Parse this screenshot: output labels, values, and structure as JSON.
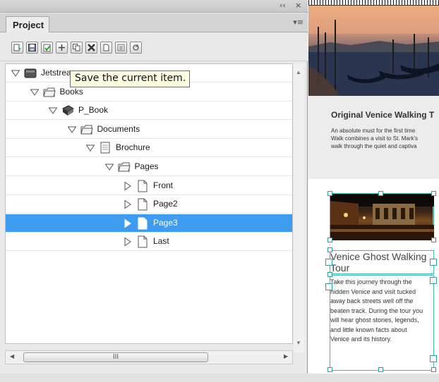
{
  "panel": {
    "collapse_glyph": "‹‹",
    "close_glyph": "×",
    "tab_label": "Project",
    "menu_glyph": "▾≡",
    "toolbar_icons": [
      "new-item-icon",
      "save-icon",
      "validate-icon",
      "add-icon",
      "duplicate-icon",
      "delete-icon",
      "page-icon",
      "properties-icon",
      "refresh-icon"
    ]
  },
  "tooltip": {
    "text": "Save the current item."
  },
  "tree": {
    "items": [
      {
        "label": "Jetstrea",
        "type": "server",
        "expanded": true,
        "depth": 0
      },
      {
        "label": "Books",
        "type": "folder",
        "expanded": true,
        "depth": 1
      },
      {
        "label": "P_Book",
        "type": "book",
        "expanded": true,
        "depth": 2
      },
      {
        "label": "Documents",
        "type": "folder",
        "expanded": true,
        "depth": 3
      },
      {
        "label": "Brochure",
        "type": "document",
        "expanded": true,
        "depth": 4
      },
      {
        "label": "Pages",
        "type": "folder",
        "expanded": true,
        "depth": 5
      },
      {
        "label": "Front",
        "type": "page",
        "expanded": false,
        "depth": 6
      },
      {
        "label": "Page2",
        "type": "page",
        "expanded": false,
        "depth": 6
      },
      {
        "label": "Page3",
        "type": "page",
        "expanded": false,
        "depth": 6,
        "selected": true
      },
      {
        "label": "Last",
        "type": "page",
        "expanded": false,
        "depth": 6
      }
    ],
    "selection_color": "#3d9bf0"
  },
  "scrollbar": {
    "thumb_grip": "III"
  },
  "preview": {
    "info_title": "Original Venice Walking T",
    "info_lines": [
      "An absolute must for the first time",
      "Walk combines a visit to St. Mark's",
      "walk through the quiet and captiva"
    ],
    "ghost_title_lines": [
      "Venice Ghost Walking",
      "Tour"
    ],
    "ghost_body_lines": [
      "Take this journey through the",
      "hidden Venice and visit tucked",
      "away back streets well off the",
      "beaten track. During the tour you",
      "will hear ghost stories, legends,",
      "and little known facts about",
      "Venice and its history."
    ],
    "frame_color": "#3bb9b5"
  }
}
